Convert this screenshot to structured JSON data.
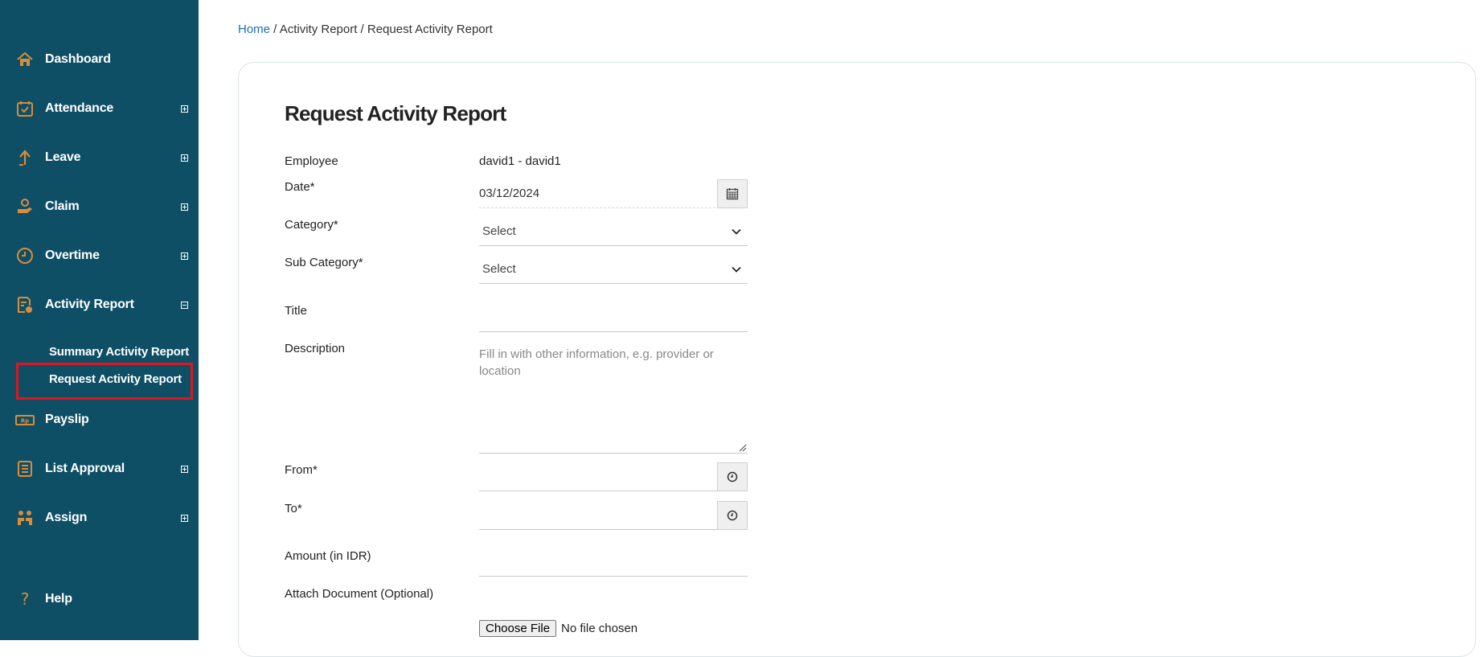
{
  "sidebar": {
    "items": [
      {
        "label": "Dashboard",
        "icon": "home-icon"
      },
      {
        "label": "Attendance",
        "icon": "calendar-check-icon",
        "expand": "plus"
      },
      {
        "label": "Leave",
        "icon": "arrow-up-icon",
        "expand": "plus"
      },
      {
        "label": "Claim",
        "icon": "hand-money-icon",
        "expand": "plus"
      },
      {
        "label": "Overtime",
        "icon": "clock-icon",
        "expand": "plus"
      },
      {
        "label": "Activity Report",
        "icon": "report-icon",
        "expand": "minus"
      },
      {
        "label": "Payslip",
        "icon": "payslip-icon"
      },
      {
        "label": "List Approval",
        "icon": "list-icon",
        "expand": "plus"
      },
      {
        "label": "Assign",
        "icon": "people-icon",
        "expand": "plus"
      },
      {
        "label": "Help",
        "icon": "question-icon"
      }
    ],
    "sub_items": [
      {
        "label": "Summary Activity Report"
      },
      {
        "label": "Request Activity Report",
        "selected": true
      }
    ],
    "icon_color": "#d98c3a",
    "background": "#0e4f66",
    "highlight_color": "#e0151e"
  },
  "breadcrumb": {
    "home": "Home",
    "rest": " / Activity Report / Request Activity Report"
  },
  "form": {
    "title": "Request Activity Report",
    "employee_label": "Employee",
    "employee_value": "david1 - david1",
    "date_label": "Date*",
    "date_value": "03/12/2024",
    "category_label": "Category*",
    "category_value": "Select",
    "subcategory_label": "Sub Category*",
    "subcategory_value": "Select",
    "title_label": "Title",
    "description_label": "Description",
    "description_placeholder": "Fill in with other information, e.g. provider or location",
    "from_label": "From*",
    "to_label": "To*",
    "amount_label": "Amount (in IDR)",
    "attach_label": "Attach Document (Optional)",
    "choose_file": "Choose File",
    "file_status": "No file chosen"
  }
}
